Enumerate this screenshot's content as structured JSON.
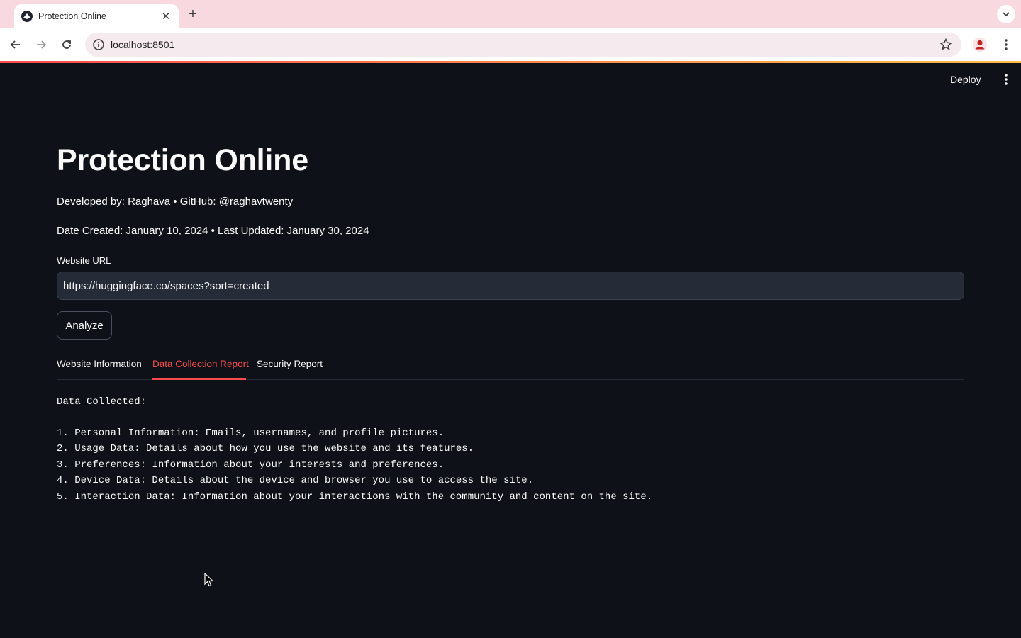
{
  "browser": {
    "tab_title": "Protection Online",
    "url": "localhost:8501"
  },
  "app_header": {
    "deploy_label": "Deploy"
  },
  "main": {
    "title": "Protection Online",
    "developed_by": "Developed by: Raghava • GitHub: @raghavtwenty",
    "dates": "Date Created: January 10, 2024 • Last Updated: January 30, 2024",
    "url_label": "Website URL",
    "url_value": "https://huggingface.co/spaces?sort=created",
    "analyze_label": "Analyze",
    "tabs": [
      {
        "label": "Website Information",
        "active": false
      },
      {
        "label": "Data Collection Report",
        "active": true
      },
      {
        "label": "Security Report",
        "active": false
      }
    ],
    "report": {
      "heading": "Data Collected:",
      "lines": [
        "1. Personal Information: Emails, usernames, and profile pictures.",
        "2. Usage Data: Details about how you use the website and its features.",
        "3. Preferences: Information about your interests and preferences.",
        "4. Device Data: Details about the device and browser you use to access the site.",
        "5. Interaction Data: Information about your interactions with the community and content on the site."
      ]
    }
  },
  "colors": {
    "background": "#0e1117",
    "accent": "#ff4b4b",
    "tabstrip": "#f8d9df",
    "input_bg": "#262b38"
  },
  "icons": [
    "streamlit-favicon-icon",
    "close-icon",
    "plus-icon",
    "chevron-down-icon",
    "back-arrow-icon",
    "forward-arrow-icon",
    "reload-icon",
    "info-icon",
    "star-icon",
    "profile-icon",
    "kebab-menu-icon",
    "cursor-icon"
  ]
}
